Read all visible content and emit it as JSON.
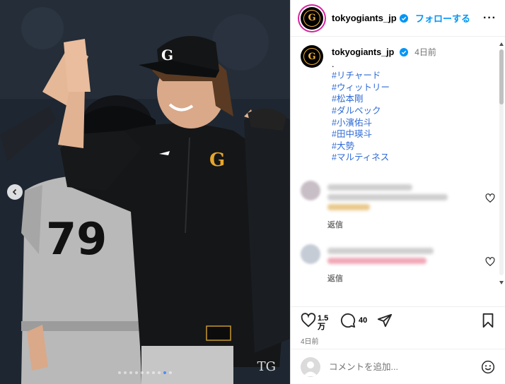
{
  "post": {
    "username": "tokyogiants_jp",
    "follow_label": "フォローする",
    "more_label": "···",
    "watermark": "TG"
  },
  "caption": {
    "username": "tokyogiants_jp",
    "time": "4日前",
    "dot": ".",
    "hashtags": [
      "#リチャード",
      "#ウィットリー",
      "#松本剛",
      "#ダルベック",
      "#小濱佑斗",
      "#田中瑛斗",
      "#大勢",
      "#マルティネス"
    ]
  },
  "comments": [
    {
      "reply_label": "返信"
    },
    {
      "reply_label": "返信"
    }
  ],
  "actions": {
    "likes_top": "1.5",
    "likes_bottom": "万",
    "comments_count": "40",
    "date": "4日前"
  },
  "composer": {
    "placeholder": "コメントを追加..."
  },
  "carousel": {
    "dot_count": 10,
    "active_index": 8
  },
  "colors": {
    "accent": "#0095f6",
    "hashtag": "#00376b",
    "brand_orange": "#f3b23a"
  }
}
